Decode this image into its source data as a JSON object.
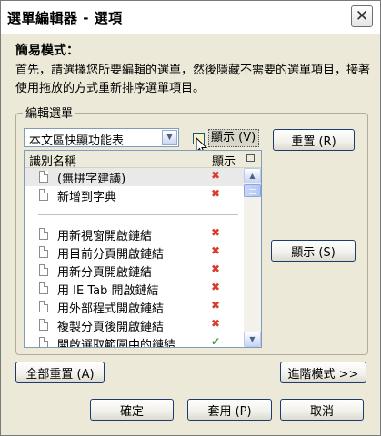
{
  "dialog": {
    "title": "選單編輯器 - 選項",
    "close_glyph": "✕"
  },
  "mode": {
    "heading": "簡易模式：",
    "description": "首先，請選擇您所要編輯的選單，然後隱藏不需要的選單項目，接著使用拖放的方式重新排序選單項目。"
  },
  "edit_menu": {
    "group_label": "編輯選單",
    "menu_select": {
      "value": "本文區快顯功能表"
    },
    "show_checkbox": {
      "label": "顯示 (V)",
      "checked": false
    },
    "reset_button": "重置 (R)",
    "show_button": "顯示 (S)",
    "list": {
      "columns": [
        "識別名稱",
        "顯示"
      ],
      "items": [
        {
          "label": "(無拼字建議)",
          "visible": false,
          "mark": "✖"
        },
        {
          "label": "新增到字典",
          "visible": false,
          "mark": "✖"
        },
        {
          "label": "",
          "separator": true
        },
        {
          "label": "用新視窗開啟鏈結",
          "visible": false,
          "mark": "✖"
        },
        {
          "label": "用目前分頁開啟鏈結",
          "visible": false,
          "mark": "✖"
        },
        {
          "label": "用新分頁開啟鏈結",
          "visible": false,
          "mark": "✖"
        },
        {
          "label": "用 IE Tab 開啟鏈結",
          "visible": false,
          "mark": "✖"
        },
        {
          "label": "用外部程式開啟鏈結",
          "visible": false,
          "mark": "✖"
        },
        {
          "label": "複製分頁後開啟鏈結",
          "visible": false,
          "mark": "✖"
        },
        {
          "label": "開啟選取範圍中的鏈結",
          "visible": true,
          "mark": "✔"
        }
      ]
    }
  },
  "footer": {
    "reset_all_button": "全部重置 (A)",
    "advanced_button": "進階模式 >>",
    "ok_button": "確定",
    "apply_button": "套用 (P)",
    "cancel_button": "取消"
  },
  "colors": {
    "dialog_bg": "#ece9d8",
    "remove_mark": "#d93c2c",
    "show_mark": "#3aa83a"
  }
}
